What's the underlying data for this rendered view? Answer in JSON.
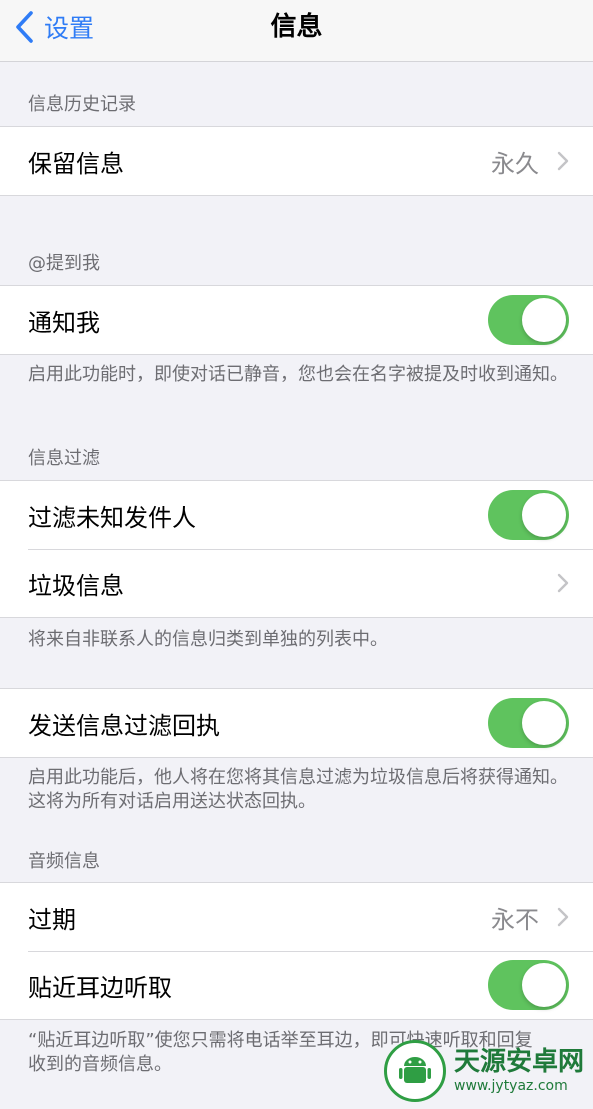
{
  "nav": {
    "back_label": "设置",
    "title": "信息"
  },
  "sections": {
    "history": {
      "header": "信息历史记录",
      "keep_label": "保留信息",
      "keep_value": "永久"
    },
    "mentions": {
      "header": "@提到我",
      "notify_label": "通知我",
      "notify_on": true,
      "footer": "启用此功能时，即使对话已静音，您也会在名字被提及时收到通知。"
    },
    "filter": {
      "header": "信息过滤",
      "unknown_label": "过滤未知发件人",
      "unknown_on": true,
      "junk_label": "垃圾信息",
      "footer": "将来自非联系人的信息归类到单独的列表中。"
    },
    "receipts": {
      "send_filter_label": "发送信息过滤回执",
      "send_filter_on": true,
      "footer": "启用此功能后，他人将在您将其信息过滤为垃圾信息后将获得通知。这将为所有对话启用送达状态回执。"
    },
    "audio": {
      "header": "音频信息",
      "expire_label": "过期",
      "expire_value": "永不",
      "raise_label": "贴近耳边听取",
      "raise_on": true,
      "footer": "“贴近耳边听取”使您只需将电话举至耳边，即可快速听取和回复收到的音频信息。"
    }
  },
  "watermark": {
    "title": "天源安卓网",
    "url": "www.jytyaz.com"
  },
  "colors": {
    "accent": "#2f7cf6",
    "toggle_on": "#5fc35e",
    "background": "#f2f2f7"
  }
}
